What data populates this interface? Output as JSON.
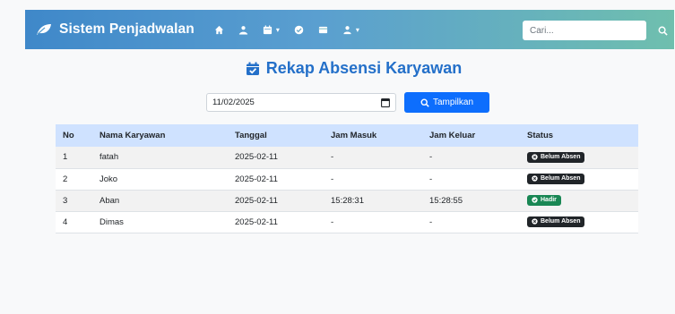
{
  "navbar": {
    "brand": "Sistem Penjadwalan",
    "icons": [
      "home-icon",
      "users-icon",
      "calendar-dropdown-icon",
      "check-circle-icon",
      "id-card-icon",
      "user-dropdown-icon"
    ],
    "search_placeholder": "Cari...",
    "colors": {
      "gradient_start": "#3f88c9",
      "gradient_end": "#6fbfae"
    }
  },
  "page": {
    "title": "Rekap Absensi Karyawan",
    "title_color": "#2470c9"
  },
  "filter": {
    "date_value": "11/02/2025",
    "button_label": "Tampilkan",
    "button_color": "#0d6efd"
  },
  "table": {
    "headers": [
      "No",
      "Nama Karyawan",
      "Tanggal",
      "Jam Masuk",
      "Jam Keluar",
      "Status"
    ],
    "rows": [
      {
        "no": "1",
        "name": "fatah",
        "date": "2025-02-11",
        "in": "-",
        "out": "-",
        "status": "Belum Absen"
      },
      {
        "no": "2",
        "name": "Joko",
        "date": "2025-02-11",
        "in": "-",
        "out": "-",
        "status": "Belum Absen"
      },
      {
        "no": "3",
        "name": "Aban",
        "date": "2025-02-11",
        "in": "15:28:31",
        "out": "15:28:55",
        "status": "Hadir"
      },
      {
        "no": "4",
        "name": "Dimas",
        "date": "2025-02-11",
        "in": "-",
        "out": "-",
        "status": "Belum Absen"
      }
    ],
    "status_colors": {
      "Belum Absen": "#212529",
      "Hadir": "#198754"
    }
  }
}
